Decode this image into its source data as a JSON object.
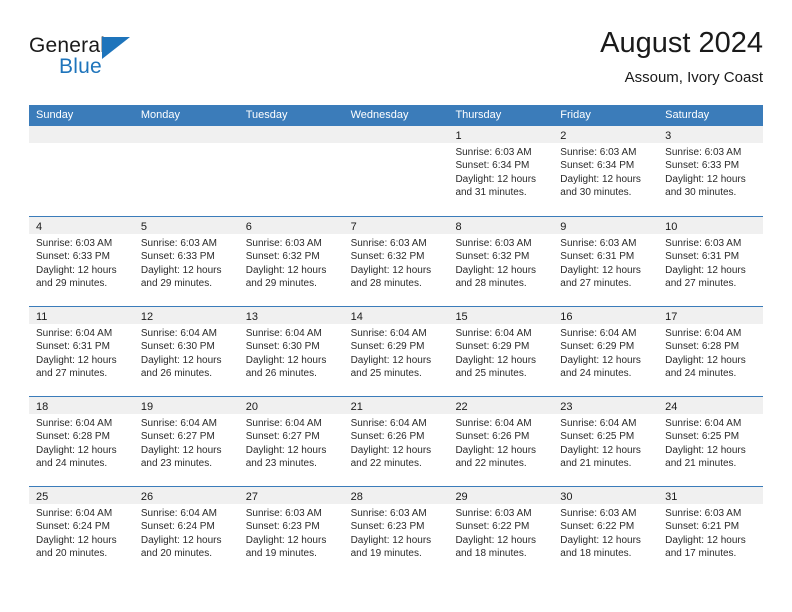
{
  "brand": {
    "word1": "General",
    "word2": "Blue",
    "logo_icon": "triangle-icon",
    "accent_color": "#1e74bb"
  },
  "header": {
    "title": "August 2024",
    "subtitle": "Assoum, Ivory Coast"
  },
  "calendar": {
    "header_color": "#3b7cba",
    "day_band_color": "#f0f0f0",
    "weekday_names": [
      "Sunday",
      "Monday",
      "Tuesday",
      "Wednesday",
      "Thursday",
      "Friday",
      "Saturday"
    ],
    "weeks": [
      [
        {
          "day": "",
          "empty": true
        },
        {
          "day": "",
          "empty": true
        },
        {
          "day": "",
          "empty": true
        },
        {
          "day": "",
          "empty": true
        },
        {
          "day": "1",
          "sunrise": "Sunrise: 6:03 AM",
          "sunset": "Sunset: 6:34 PM",
          "daylight1": "Daylight: 12 hours",
          "daylight2": "and 31 minutes."
        },
        {
          "day": "2",
          "sunrise": "Sunrise: 6:03 AM",
          "sunset": "Sunset: 6:34 PM",
          "daylight1": "Daylight: 12 hours",
          "daylight2": "and 30 minutes."
        },
        {
          "day": "3",
          "sunrise": "Sunrise: 6:03 AM",
          "sunset": "Sunset: 6:33 PM",
          "daylight1": "Daylight: 12 hours",
          "daylight2": "and 30 minutes."
        }
      ],
      [
        {
          "day": "4",
          "sunrise": "Sunrise: 6:03 AM",
          "sunset": "Sunset: 6:33 PM",
          "daylight1": "Daylight: 12 hours",
          "daylight2": "and 29 minutes."
        },
        {
          "day": "5",
          "sunrise": "Sunrise: 6:03 AM",
          "sunset": "Sunset: 6:33 PM",
          "daylight1": "Daylight: 12 hours",
          "daylight2": "and 29 minutes."
        },
        {
          "day": "6",
          "sunrise": "Sunrise: 6:03 AM",
          "sunset": "Sunset: 6:32 PM",
          "daylight1": "Daylight: 12 hours",
          "daylight2": "and 29 minutes."
        },
        {
          "day": "7",
          "sunrise": "Sunrise: 6:03 AM",
          "sunset": "Sunset: 6:32 PM",
          "daylight1": "Daylight: 12 hours",
          "daylight2": "and 28 minutes."
        },
        {
          "day": "8",
          "sunrise": "Sunrise: 6:03 AM",
          "sunset": "Sunset: 6:32 PM",
          "daylight1": "Daylight: 12 hours",
          "daylight2": "and 28 minutes."
        },
        {
          "day": "9",
          "sunrise": "Sunrise: 6:03 AM",
          "sunset": "Sunset: 6:31 PM",
          "daylight1": "Daylight: 12 hours",
          "daylight2": "and 27 minutes."
        },
        {
          "day": "10",
          "sunrise": "Sunrise: 6:03 AM",
          "sunset": "Sunset: 6:31 PM",
          "daylight1": "Daylight: 12 hours",
          "daylight2": "and 27 minutes."
        }
      ],
      [
        {
          "day": "11",
          "sunrise": "Sunrise: 6:04 AM",
          "sunset": "Sunset: 6:31 PM",
          "daylight1": "Daylight: 12 hours",
          "daylight2": "and 27 minutes."
        },
        {
          "day": "12",
          "sunrise": "Sunrise: 6:04 AM",
          "sunset": "Sunset: 6:30 PM",
          "daylight1": "Daylight: 12 hours",
          "daylight2": "and 26 minutes."
        },
        {
          "day": "13",
          "sunrise": "Sunrise: 6:04 AM",
          "sunset": "Sunset: 6:30 PM",
          "daylight1": "Daylight: 12 hours",
          "daylight2": "and 26 minutes."
        },
        {
          "day": "14",
          "sunrise": "Sunrise: 6:04 AM",
          "sunset": "Sunset: 6:29 PM",
          "daylight1": "Daylight: 12 hours",
          "daylight2": "and 25 minutes."
        },
        {
          "day": "15",
          "sunrise": "Sunrise: 6:04 AM",
          "sunset": "Sunset: 6:29 PM",
          "daylight1": "Daylight: 12 hours",
          "daylight2": "and 25 minutes."
        },
        {
          "day": "16",
          "sunrise": "Sunrise: 6:04 AM",
          "sunset": "Sunset: 6:29 PM",
          "daylight1": "Daylight: 12 hours",
          "daylight2": "and 24 minutes."
        },
        {
          "day": "17",
          "sunrise": "Sunrise: 6:04 AM",
          "sunset": "Sunset: 6:28 PM",
          "daylight1": "Daylight: 12 hours",
          "daylight2": "and 24 minutes."
        }
      ],
      [
        {
          "day": "18",
          "sunrise": "Sunrise: 6:04 AM",
          "sunset": "Sunset: 6:28 PM",
          "daylight1": "Daylight: 12 hours",
          "daylight2": "and 24 minutes."
        },
        {
          "day": "19",
          "sunrise": "Sunrise: 6:04 AM",
          "sunset": "Sunset: 6:27 PM",
          "daylight1": "Daylight: 12 hours",
          "daylight2": "and 23 minutes."
        },
        {
          "day": "20",
          "sunrise": "Sunrise: 6:04 AM",
          "sunset": "Sunset: 6:27 PM",
          "daylight1": "Daylight: 12 hours",
          "daylight2": "and 23 minutes."
        },
        {
          "day": "21",
          "sunrise": "Sunrise: 6:04 AM",
          "sunset": "Sunset: 6:26 PM",
          "daylight1": "Daylight: 12 hours",
          "daylight2": "and 22 minutes."
        },
        {
          "day": "22",
          "sunrise": "Sunrise: 6:04 AM",
          "sunset": "Sunset: 6:26 PM",
          "daylight1": "Daylight: 12 hours",
          "daylight2": "and 22 minutes."
        },
        {
          "day": "23",
          "sunrise": "Sunrise: 6:04 AM",
          "sunset": "Sunset: 6:25 PM",
          "daylight1": "Daylight: 12 hours",
          "daylight2": "and 21 minutes."
        },
        {
          "day": "24",
          "sunrise": "Sunrise: 6:04 AM",
          "sunset": "Sunset: 6:25 PM",
          "daylight1": "Daylight: 12 hours",
          "daylight2": "and 21 minutes."
        }
      ],
      [
        {
          "day": "25",
          "sunrise": "Sunrise: 6:04 AM",
          "sunset": "Sunset: 6:24 PM",
          "daylight1": "Daylight: 12 hours",
          "daylight2": "and 20 minutes."
        },
        {
          "day": "26",
          "sunrise": "Sunrise: 6:04 AM",
          "sunset": "Sunset: 6:24 PM",
          "daylight1": "Daylight: 12 hours",
          "daylight2": "and 20 minutes."
        },
        {
          "day": "27",
          "sunrise": "Sunrise: 6:03 AM",
          "sunset": "Sunset: 6:23 PM",
          "daylight1": "Daylight: 12 hours",
          "daylight2": "and 19 minutes."
        },
        {
          "day": "28",
          "sunrise": "Sunrise: 6:03 AM",
          "sunset": "Sunset: 6:23 PM",
          "daylight1": "Daylight: 12 hours",
          "daylight2": "and 19 minutes."
        },
        {
          "day": "29",
          "sunrise": "Sunrise: 6:03 AM",
          "sunset": "Sunset: 6:22 PM",
          "daylight1": "Daylight: 12 hours",
          "daylight2": "and 18 minutes."
        },
        {
          "day": "30",
          "sunrise": "Sunrise: 6:03 AM",
          "sunset": "Sunset: 6:22 PM",
          "daylight1": "Daylight: 12 hours",
          "daylight2": "and 18 minutes."
        },
        {
          "day": "31",
          "sunrise": "Sunrise: 6:03 AM",
          "sunset": "Sunset: 6:21 PM",
          "daylight1": "Daylight: 12 hours",
          "daylight2": "and 17 minutes."
        }
      ]
    ]
  }
}
